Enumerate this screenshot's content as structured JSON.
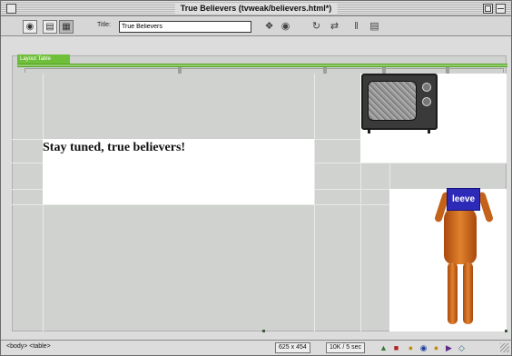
{
  "window": {
    "title": "True Believers (tvweak/believers.html*)"
  },
  "toolbar": {
    "title_label": "Title:",
    "title_value": "True Believers"
  },
  "layout": {
    "tab_label": "Layout Table",
    "heading": "Stay tuned, true believers!",
    "sign_text": "leeve"
  },
  "statusbar": {
    "tag_selector": "<body> <table>",
    "window_size": "625 x 454",
    "download_stats": "10K / 5 sec"
  },
  "colors": {
    "layout_green": "#6fbf3a",
    "cell_bg": "#cfd2cf",
    "sign_blue": "#2e2ab8"
  }
}
